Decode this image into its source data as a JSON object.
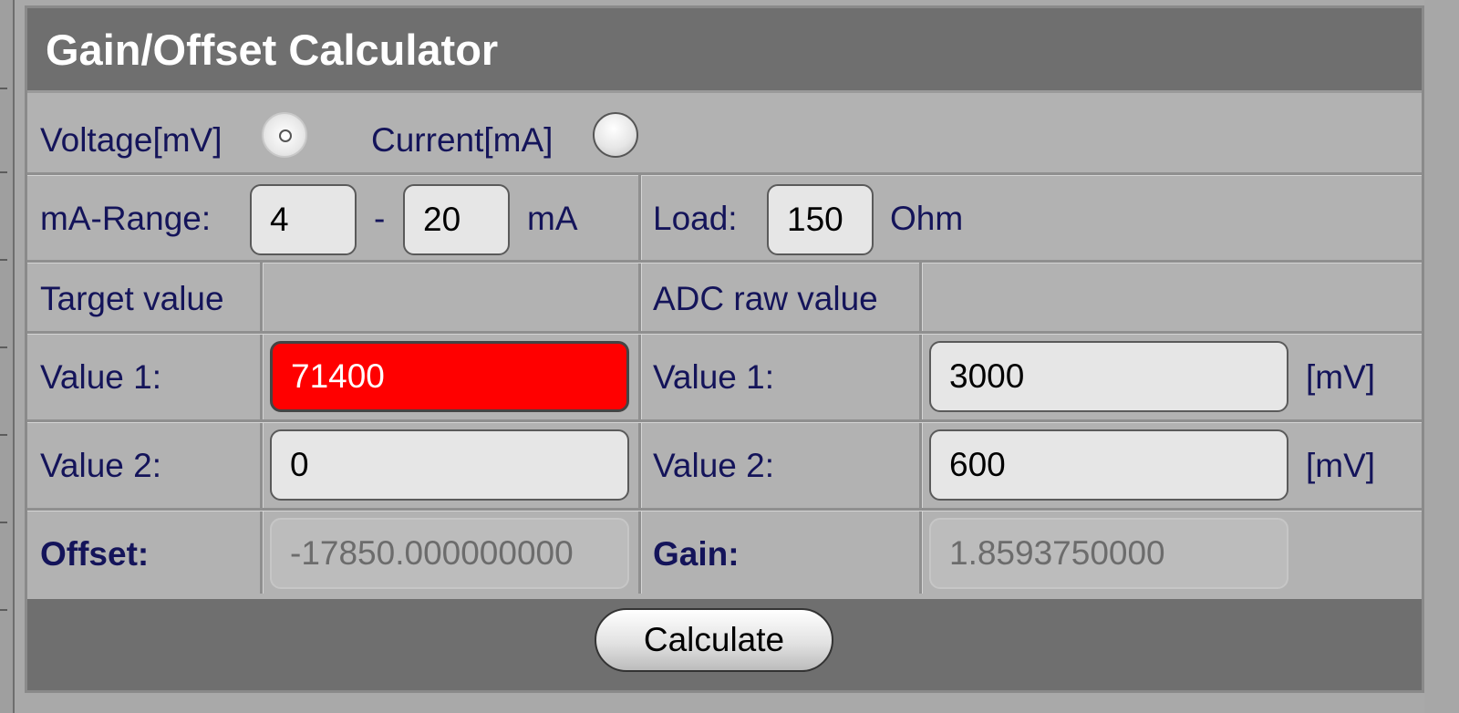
{
  "title": "Gain/Offset Calculator",
  "mode": {
    "voltage_label": "Voltage[mV]",
    "current_label": "Current[mA]",
    "selected": "voltage"
  },
  "range": {
    "label": "mA-Range:",
    "min": "4",
    "separator": "-",
    "max": "20",
    "unit": "mA"
  },
  "load": {
    "label": "Load:",
    "value": "150",
    "unit": "Ohm"
  },
  "target": {
    "header": "Target value",
    "value1_label": "Value 1:",
    "value1": "71400",
    "value2_label": "Value 2:",
    "value2": "0"
  },
  "adc": {
    "header": "ADC raw value",
    "value1_label": "Value 1:",
    "value1": "3000",
    "value1_unit": "[mV]",
    "value2_label": "Value 2:",
    "value2": "600",
    "value2_unit": "[mV]"
  },
  "result": {
    "offset_label": "Offset:",
    "offset_value": "-17850.000000000",
    "gain_label": "Gain:",
    "gain_value": "1.8593750000"
  },
  "calculate_label": "Calculate",
  "colors": {
    "error_field": "#ff0000",
    "title_bar": "#6f6f6f",
    "label_text": "#14145a"
  }
}
